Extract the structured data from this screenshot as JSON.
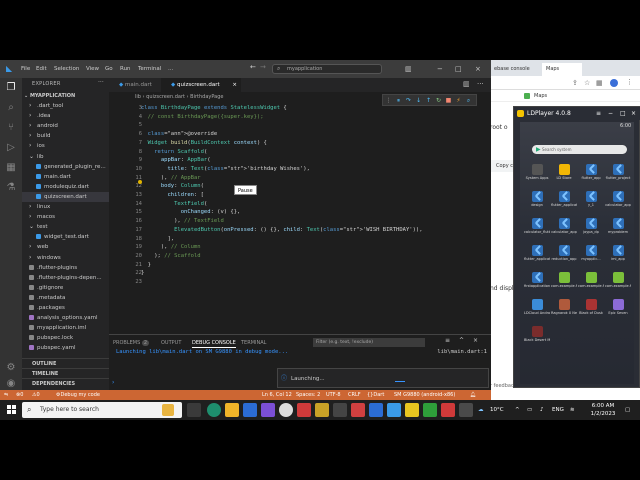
{
  "browser": {
    "tab1": "ebase console",
    "tab2": "Maps",
    "text_root": "root o",
    "copy_button": "Copy c",
    "text_displ": "nd displ",
    "text_feedback": "r feedback will help us improve."
  },
  "ldplayer": {
    "title": "LDPlayer 4.0.8",
    "time": "6:00",
    "search_placeholder": "Search system",
    "apps": [
      {
        "label": "System Apps",
        "color": "#555"
      },
      {
        "label": "LD Store",
        "color": "#f2b705"
      },
      {
        "label": "flutter_app",
        "color": "flutter"
      },
      {
        "label": "flutter_project",
        "color": "flutter"
      },
      {
        "label": "design",
        "color": "flutter"
      },
      {
        "label": "flutter_applicatio...",
        "color": "flutter"
      },
      {
        "label": "y_1",
        "color": "flutter"
      },
      {
        "label": "calculator_app",
        "color": "flutter"
      },
      {
        "label": "calculator_flutter",
        "color": "flutter"
      },
      {
        "label": "calculator_app",
        "color": "flutter"
      },
      {
        "label": "joypa_dp",
        "color": "flutter"
      },
      {
        "label": "myproblem",
        "color": "flutter"
      },
      {
        "label": "flutter_applicatio...",
        "color": "flutter"
      },
      {
        "label": "reduction_app",
        "color": "flutter"
      },
      {
        "label": "myapplic...",
        "color": "flutter"
      },
      {
        "label": "imi_app",
        "color": "flutter"
      },
      {
        "label": "firstapplication",
        "color": "flutter"
      },
      {
        "label": "com.example.fi...",
        "color": "#7bbf3a"
      },
      {
        "label": "com.example.fl...",
        "color": "#7bbf3a"
      },
      {
        "label": "com.example.fi...",
        "color": "#7bbf3a"
      },
      {
        "label": "LDCloud Android Lite",
        "color": "#3b8cd8"
      },
      {
        "label": "Ragnarok X Next Generation",
        "color": "#b05a3c"
      },
      {
        "label": "Black of Dusk",
        "color": "#a33"
      },
      {
        "label": "Epic Seven",
        "color": "#8c6bd6"
      },
      {
        "label": "Black Desert Mobile",
        "color": "#7a2c2c"
      }
    ]
  },
  "titlebar": {
    "menus": [
      "File",
      "Edit",
      "Selection",
      "View",
      "Go",
      "Run",
      "Terminal"
    ],
    "more": "...",
    "search": "myapplication"
  },
  "explorer": {
    "header": "EXPLORER",
    "root": "MYAPPLICATION",
    "items": [
      {
        "label": ".dart_tool",
        "indent": 1,
        "type": "folder"
      },
      {
        "label": ".idea",
        "indent": 1,
        "type": "folder"
      },
      {
        "label": "android",
        "indent": 1,
        "type": "folder"
      },
      {
        "label": "build",
        "indent": 1,
        "type": "folder"
      },
      {
        "label": "ios",
        "indent": 1,
        "type": "folder"
      },
      {
        "label": "lib",
        "indent": 1,
        "type": "folder-open"
      },
      {
        "label": "generated_plugin_re...",
        "indent": 2,
        "type": "dart"
      },
      {
        "label": "main.dart",
        "indent": 2,
        "type": "dart"
      },
      {
        "label": "modulequiz.dart",
        "indent": 2,
        "type": "dart"
      },
      {
        "label": "quizscreen.dart",
        "indent": 2,
        "type": "dart",
        "selected": true
      },
      {
        "label": "linux",
        "indent": 1,
        "type": "folder"
      },
      {
        "label": "macos",
        "indent": 1,
        "type": "folder"
      },
      {
        "label": "test",
        "indent": 1,
        "type": "folder-open"
      },
      {
        "label": "widget_test.dart",
        "indent": 2,
        "type": "dart"
      },
      {
        "label": "web",
        "indent": 1,
        "type": "folder"
      },
      {
        "label": "windows",
        "indent": 1,
        "type": "folder"
      },
      {
        "label": ".flutter-plugins",
        "indent": 1,
        "type": "file"
      },
      {
        "label": ".flutter-plugins-depen...",
        "indent": 1,
        "type": "file"
      },
      {
        "label": ".gitignore",
        "indent": 1,
        "type": "file"
      },
      {
        "label": ".metadata",
        "indent": 1,
        "type": "file"
      },
      {
        "label": ".packages",
        "indent": 1,
        "type": "file"
      },
      {
        "label": "analysis_options.yaml",
        "indent": 1,
        "type": "yaml"
      },
      {
        "label": "myapplication.iml",
        "indent": 1,
        "type": "file"
      },
      {
        "label": "pubspec.lock",
        "indent": 1,
        "type": "file"
      },
      {
        "label": "pubspec.yaml",
        "indent": 1,
        "type": "yaml"
      }
    ],
    "outline": "OUTLINE",
    "timeline": "TIMELINE",
    "dependencies": "DEPENDENCIES"
  },
  "tabs": [
    {
      "label": "main.dart"
    },
    {
      "label": "quizscreen.dart",
      "active": true
    }
  ],
  "breadcrumb": {
    "lib": "lib",
    "file": "quizscreen.dart",
    "symbol": "BirthdayPage"
  },
  "tooltip": "Pause",
  "editor": {
    "line_numbers": [
      "3",
      "4",
      "5",
      "6",
      "7",
      "8",
      "9",
      "10",
      "11",
      "12",
      "13",
      "14",
      "15",
      "16",
      "17",
      "18",
      "19",
      "20",
      "21",
      "22",
      "23"
    ],
    "lines": [
      "class BirthdayPage extends StatelessWidget {",
      "  // const BirthdayPage({super.key});",
      "",
      "  @override",
      "  Widget build(BuildContext context) {",
      "    return Scaffold(",
      "      appBar: AppBar(",
      "        title: Text('birthday Wishes'),",
      "      ), // AppBar",
      "      body: Column(",
      "        children: [",
      "          TextField(",
      "            onChanged: (v) {},",
      "          ), // TextField",
      "          ElevatedButton(onPressed: () {}, child: Text('WISH BIRTHDAY')),",
      "        ],",
      "      ), // Column",
      "    ); // Scaffold",
      "  }",
      "}",
      ""
    ]
  },
  "panel": {
    "tabs": [
      "PROBLEMS",
      "OUTPUT",
      "DEBUG CONSOLE",
      "TERMINAL"
    ],
    "problems_count": "2",
    "filter_placeholder": "Filter (e.g. text, !exclude)",
    "message": "Launching lib\\main.dart on SM G9880 in debug mode...",
    "source": "lib\\main.dart:1"
  },
  "notification": "Launching...",
  "statusbar": {
    "debug": "Debug my code",
    "position": "Ln 6, Col 12",
    "spaces": "Spaces: 2",
    "encoding": "UTF-8",
    "eol": "CRLF",
    "language": "Dart",
    "device": "SM G9880 (android-x86)",
    "errors": "0",
    "warnings": "0"
  },
  "taskbar": {
    "search": "Type here to search",
    "weather": "10°C",
    "lang": "ENG",
    "time": "6:00 AM",
    "date": "1/2/2023"
  }
}
